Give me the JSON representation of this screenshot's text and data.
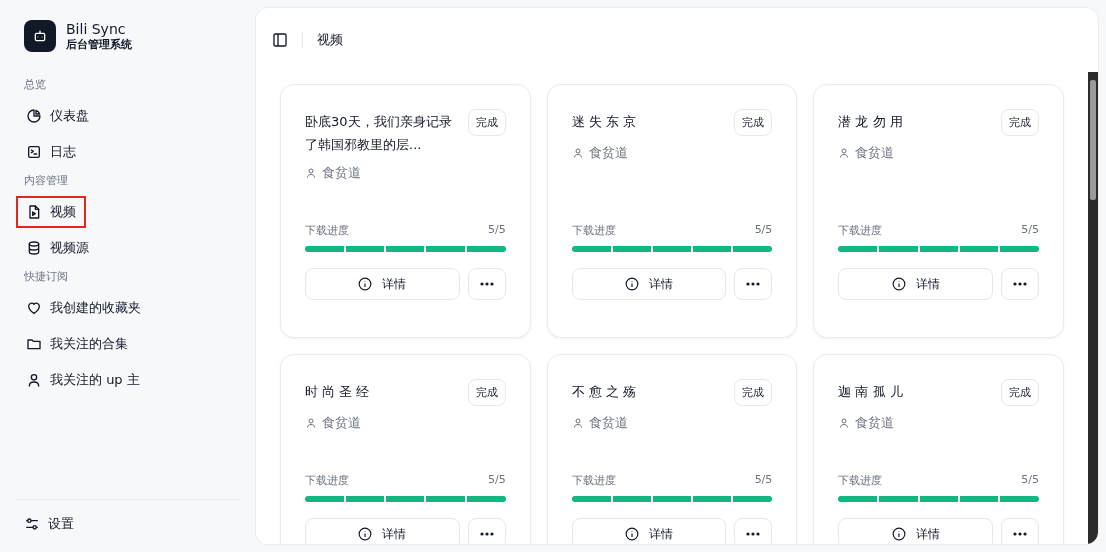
{
  "brand": {
    "title": "Bili Sync",
    "subtitle": "后台管理系统"
  },
  "sidebar": {
    "groups": [
      {
        "label": "总览",
        "items": [
          {
            "kind": "pie",
            "label": "仪表盘",
            "selected": false
          },
          {
            "kind": "terminal",
            "label": "日志",
            "selected": false
          }
        ]
      },
      {
        "label": "内容管理",
        "items": [
          {
            "kind": "video",
            "label": "视频",
            "selected": true
          },
          {
            "kind": "database",
            "label": "视频源",
            "selected": false
          }
        ]
      },
      {
        "label": "快捷订阅",
        "items": [
          {
            "kind": "heart",
            "label": "我创建的收藏夹",
            "selected": false
          },
          {
            "kind": "folder",
            "label": "我关注的合集",
            "selected": false
          },
          {
            "kind": "user",
            "label": "我关注的 up 主",
            "selected": false
          }
        ]
      }
    ],
    "footer": {
      "kind": "sliders",
      "label": "设置"
    }
  },
  "header": {
    "title": "视频"
  },
  "videos": [
    {
      "title": "卧底30天，我们亲身记录了韩国邪教里的层...",
      "status": "完成",
      "author": "食贫道",
      "progress_label": "下载进度",
      "progress_text": "5/5",
      "level": 1,
      "details": "详情"
    },
    {
      "title": "迷 失 东 京",
      "status": "完成",
      "author": "食贫道",
      "progress_label": "下载进度",
      "progress_text": "5/5",
      "level": 1,
      "details": "详情"
    },
    {
      "title": "潜 龙 勿 用",
      "status": "完成",
      "author": "食贫道",
      "progress_label": "下载进度",
      "progress_text": "5/5",
      "level": 1,
      "details": "详情"
    },
    {
      "title": "时 尚 圣 经",
      "status": "完成",
      "author": "食贫道",
      "progress_label": "下载进度",
      "progress_text": "5/5",
      "level": 1,
      "details": "详情"
    },
    {
      "title": "不 愈 之 殇",
      "status": "完成",
      "author": "食贫道",
      "progress_label": "下载进度",
      "progress_text": "5/5",
      "level": 1,
      "details": "详情"
    },
    {
      "title": "迦 南 孤 儿",
      "status": "完成",
      "author": "食贫道",
      "progress_label": "下载进度",
      "progress_text": "5/5",
      "level": 1,
      "details": "详情"
    }
  ]
}
